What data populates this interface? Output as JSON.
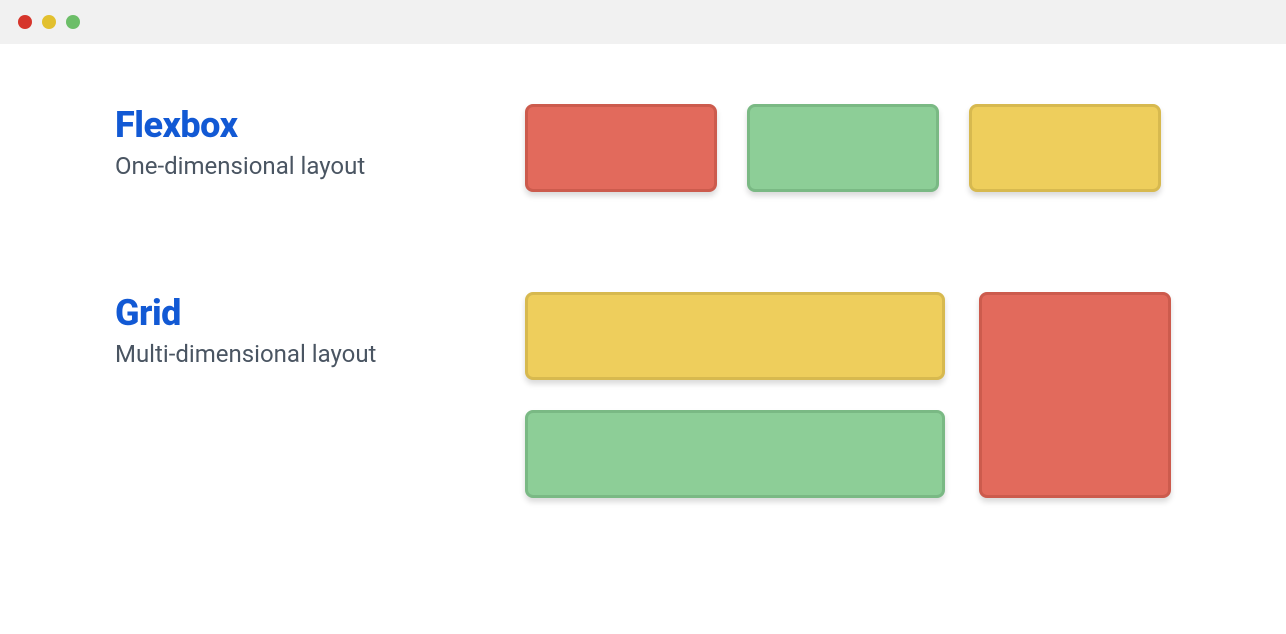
{
  "sections": {
    "flexbox": {
      "title": "Flexbox",
      "subtitle": "One-dimensional layout"
    },
    "grid": {
      "title": "Grid",
      "subtitle": "Multi-dimensional layout"
    }
  }
}
